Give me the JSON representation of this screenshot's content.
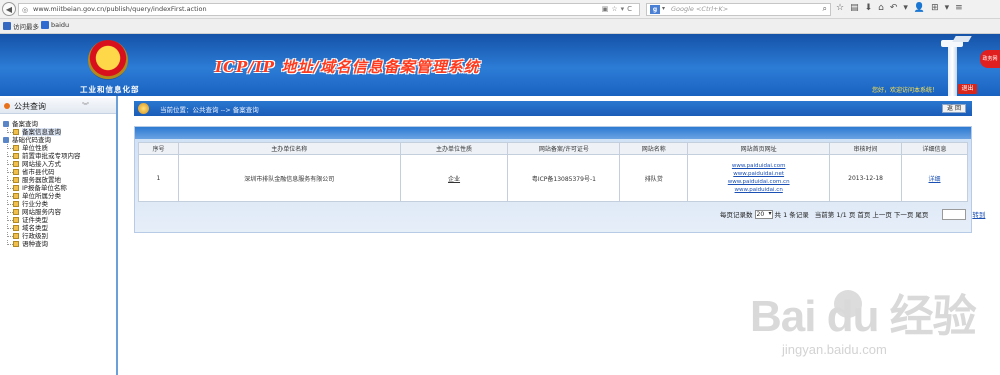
{
  "browser": {
    "url": "www.miitbeian.gov.cn/publish/query/indexFirst.action",
    "search_placeholder": "Google <Ctrl+K>",
    "bookmarks": [
      "访问最多",
      "baidu"
    ]
  },
  "banner": {
    "ministry": "工业和信息化部",
    "title": "ICP/IP 地址/域名信息备案管理系统",
    "welcome": "您好，欢迎访问本系统！",
    "logout": "退出",
    "corner": "政务网"
  },
  "sidebar": {
    "title": "公共查询",
    "groups": [
      {
        "label": "备案查询",
        "items": [
          "备案信息查询"
        ]
      },
      {
        "label": "基础代码查询",
        "items": [
          "单位性质",
          "前置审批或专项内容",
          "网站接入方式",
          "省市县代码",
          "服务器放置地",
          "IP报备单位名称",
          "单位所属分类",
          "行业分类",
          "网站服务内容",
          "证件类型",
          "域名类型",
          "行政级别",
          "语种查询"
        ]
      }
    ]
  },
  "main": {
    "breadcrumb": "当前位置：公共查询  -->  备案查询",
    "back_button": "返 回",
    "table": {
      "headers": [
        "序号",
        "主办单位名称",
        "主办单位性质",
        "网站备案/许可证号",
        "网站名称",
        "网站首页网址",
        "审核时间",
        "详细信息"
      ],
      "rows": [
        {
          "index": "1",
          "org_name": "深圳市排队金融信息服务有限公司",
          "org_type": "企业",
          "license": "粤ICP备13085379号-1",
          "site_name": "排队贷",
          "urls": [
            "www.paiduidai.com",
            "www.paiduidai.net",
            "www.paiduidai.com.cn",
            "www.paiduidai.cn"
          ],
          "audit_date": "2013-12-18",
          "detail": "详细"
        }
      ]
    },
    "pager": {
      "per_page_label": "每页记录数",
      "per_page_value": "20",
      "total": "共 1 条记录",
      "page": "当前第 1/1 页",
      "first": "首页",
      "prev": "上一页",
      "next": "下一页",
      "last": "尾页",
      "go": "转到"
    }
  },
  "watermark": {
    "logo": "Bai du 经验",
    "sub": "jingyan.baidu.com"
  },
  "colors": {
    "banner": "#1a62c0",
    "title_red": "#ff3b1f",
    "link_blue": "#1a4fb4",
    "logout_red": "#d9261c"
  }
}
